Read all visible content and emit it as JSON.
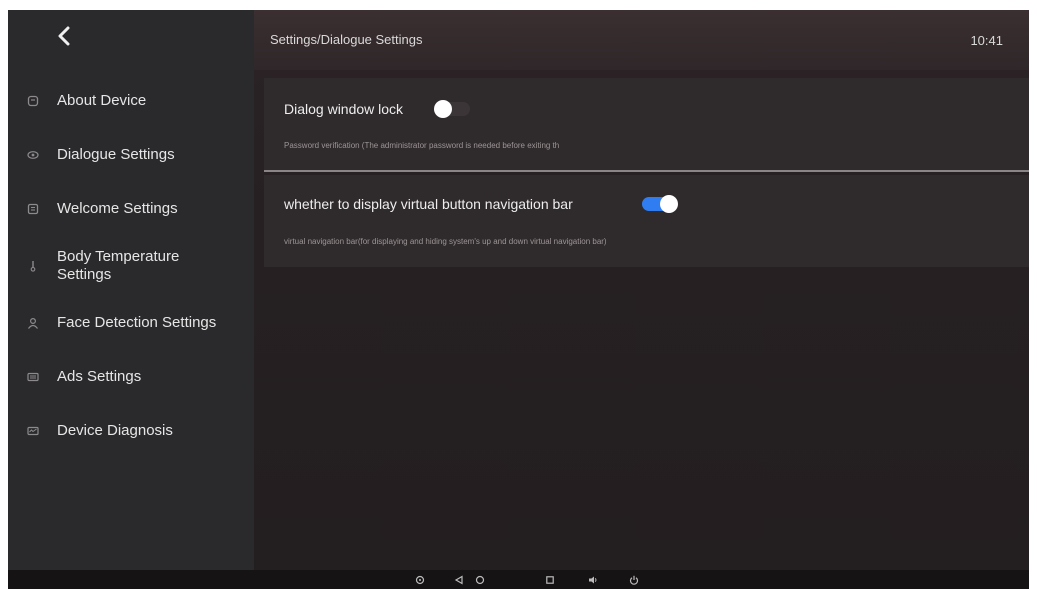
{
  "header": {
    "breadcrumb": "Settings/Dialogue Settings",
    "clock": "10:41"
  },
  "sidebar": {
    "items": [
      {
        "label": "About Device",
        "icon": "device-icon"
      },
      {
        "label": "Dialogue Settings",
        "icon": "eye-icon"
      },
      {
        "label": "Welcome Settings",
        "icon": "welcome-icon"
      },
      {
        "label": "Body Temperature Settings",
        "icon": "thermometer-icon"
      },
      {
        "label": "Face Detection Settings",
        "icon": "person-icon"
      },
      {
        "label": "Ads Settings",
        "icon": "ads-icon"
      },
      {
        "label": "Device Diagnosis",
        "icon": "diagnosis-icon"
      }
    ]
  },
  "settings": {
    "dialog_lock": {
      "title": "Dialog window lock",
      "description": "Password verification (The administrator password is needed before exiting th",
      "enabled": false
    },
    "nav_bar": {
      "title": "whether to display virtual button navigation bar",
      "description": "virtual navigation bar(for displaying and hiding system's up and down virtual navigation bar)",
      "enabled": true
    }
  },
  "colors": {
    "accent": "#2f7df0",
    "background": "#241f22",
    "sidebar": "#2a2a2d"
  }
}
